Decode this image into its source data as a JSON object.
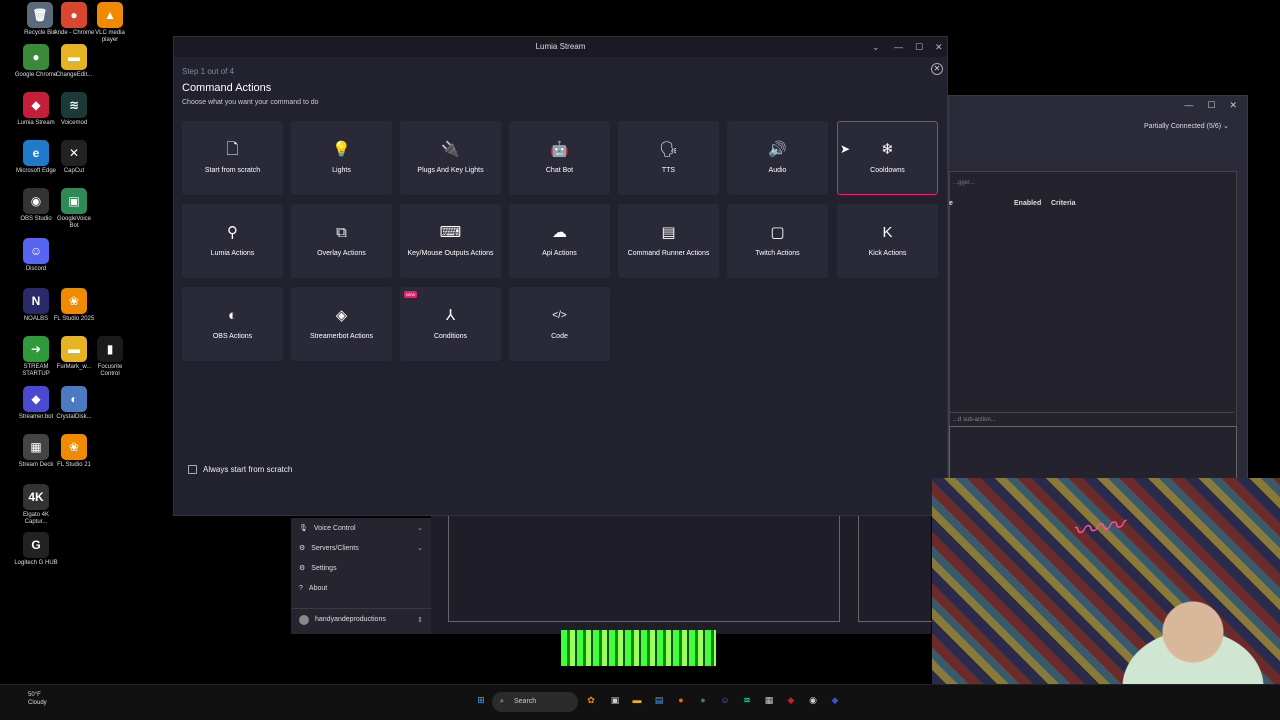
{
  "desktop": {
    "icons": [
      {
        "label": "Recycle Bin",
        "color": "#5a6a7a",
        "glyph": "🗑"
      },
      {
        "label": "Ande - Chrome",
        "color": "#d9462f",
        "glyph": "●"
      },
      {
        "label": "VLC media player",
        "color": "#f08a00",
        "glyph": "▲"
      },
      {
        "label": "Google Chrome",
        "color": "#3a8a3a",
        "glyph": "●"
      },
      {
        "label": "ChangeEdit...",
        "color": "#e6b422",
        "glyph": "▬"
      },
      {
        "label": "Lumia Stream",
        "color": "#c41e3a",
        "glyph": "◆"
      },
      {
        "label": "Voicemod",
        "color": "#1a3a3a",
        "glyph": "≋"
      },
      {
        "label": "Microsoft Edge",
        "color": "#1f7ac9",
        "glyph": "e"
      },
      {
        "label": "CapCut",
        "color": "#222222",
        "glyph": "✕"
      },
      {
        "label": "OBS Studio",
        "color": "#333333",
        "glyph": "◉"
      },
      {
        "label": "GoogleVoice Bot",
        "color": "#2e8b57",
        "glyph": "▣"
      },
      {
        "label": "Discord",
        "color": "#5865f2",
        "glyph": "☺"
      },
      {
        "label": "NOALBS",
        "color": "#2a2a6a",
        "glyph": "N"
      },
      {
        "label": "FL Studio 2025",
        "color": "#f08a00",
        "glyph": "❀"
      },
      {
        "label": "STREAM STARTUP",
        "color": "#2e9a3a",
        "glyph": "➜"
      },
      {
        "label": "FurMark_w...",
        "color": "#e6b422",
        "glyph": "▬"
      },
      {
        "label": "Focusrite Control",
        "color": "#1a1a1a",
        "glyph": "▮"
      },
      {
        "label": "Streamer.bot",
        "color": "#4a4ad0",
        "glyph": "◆"
      },
      {
        "label": "CrystalDisk...",
        "color": "#4a7ac0",
        "glyph": "◐"
      },
      {
        "label": "Stream Deck",
        "color": "#444444",
        "glyph": "▦"
      },
      {
        "label": "FL Studio 21",
        "color": "#f08a00",
        "glyph": "❀"
      },
      {
        "label": "Elgato 4K Captur...",
        "color": "#333333",
        "glyph": "4K"
      },
      {
        "label": "Logitech G HUB",
        "color": "#222222",
        "glyph": "G"
      }
    ]
  },
  "bg_app": {
    "status": "Partially Connected (5/6)",
    "search_placeholder": "...gger...",
    "col_name": "e",
    "col_enabled": "Enabled",
    "col_criteria": "Criteria",
    "sub_placeholder": "...d sub-action..."
  },
  "lumia_sidebar": {
    "items": [
      {
        "label": "Voice Control",
        "icon": "🎙",
        "chevron": "⌄"
      },
      {
        "label": "Servers/Clients",
        "icon": "⚙",
        "chevron": "⌄"
      },
      {
        "label": "Settings",
        "icon": "⚙",
        "chevron": ""
      },
      {
        "label": "About",
        "icon": "?",
        "chevron": ""
      }
    ],
    "user": "handyandeproductions"
  },
  "dialog": {
    "title": "Lumia Stream",
    "step": "Step 1 out of 4",
    "heading": "Command Actions",
    "subheading": "Choose what you want your command to do",
    "checkbox_label": "Always start from scratch",
    "accent": "#e2236b",
    "cards": [
      {
        "label": "Start from scratch",
        "icon": "🗋"
      },
      {
        "label": "Lights",
        "icon": "💡"
      },
      {
        "label": "Plugs And Key Lights",
        "icon": "🔌"
      },
      {
        "label": "Chat Bot",
        "icon": "🤖"
      },
      {
        "label": "TTS",
        "icon": "🗣"
      },
      {
        "label": "Audio",
        "icon": "🔊"
      },
      {
        "label": "Cooldowns",
        "icon": "❄"
      },
      {
        "label": "Lumia Actions",
        "icon": "⚲"
      },
      {
        "label": "Overlay Actions",
        "icon": "⧉"
      },
      {
        "label": "Key/Mouse Outputs Actions",
        "icon": "⌨"
      },
      {
        "label": "Api Actions",
        "icon": "☁"
      },
      {
        "label": "Command Runner Actions",
        "icon": "▤"
      },
      {
        "label": "Twitch Actions",
        "icon": "▢"
      },
      {
        "label": "Kick Actions",
        "icon": "K"
      },
      {
        "label": "OBS Actions",
        "icon": "◐"
      },
      {
        "label": "Streamerbot Actions",
        "icon": "◈"
      },
      {
        "label": "Conditions",
        "icon": "⅄",
        "badge": "NEW"
      },
      {
        "label": "Code",
        "icon": "</>"
      }
    ]
  },
  "taskbar": {
    "weather_temp": "50°F",
    "weather_desc": "Cloudy",
    "search_label": "Search"
  }
}
